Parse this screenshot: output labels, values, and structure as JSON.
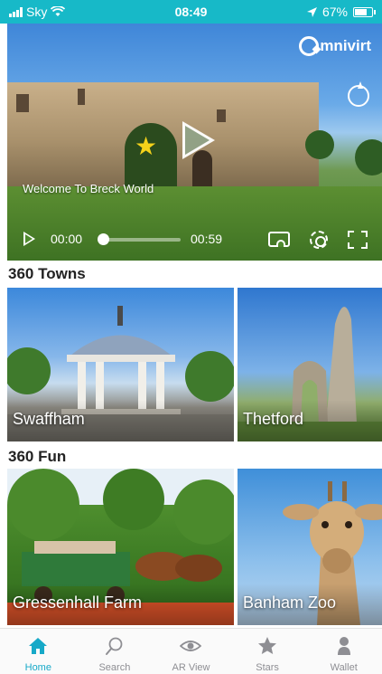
{
  "status_bar": {
    "carrier": "Sky",
    "time": "08:49",
    "battery": "67%"
  },
  "hero": {
    "brand": "mnivirt",
    "caption": "Welcome To Breck World",
    "current_time": "00:00",
    "duration": "00:59",
    "progress": 0
  },
  "towns": {
    "title": "360 Towns",
    "items": [
      {
        "label": "Swaffham"
      },
      {
        "label": "Thetford"
      }
    ]
  },
  "fun": {
    "title": "360 Fun",
    "items": [
      {
        "label": "Gressenhall Farm"
      },
      {
        "label": "Banham Zoo"
      }
    ]
  },
  "tabbar": {
    "items": [
      {
        "label": "Home",
        "icon": "home-icon",
        "active": true
      },
      {
        "label": "Search",
        "icon": "search-icon",
        "active": false
      },
      {
        "label": "AR View",
        "icon": "eye-icon",
        "active": false
      },
      {
        "label": "Stars",
        "icon": "star-icon",
        "active": false
      },
      {
        "label": "Wallet",
        "icon": "wallet-icon",
        "active": false
      }
    ]
  },
  "colors": {
    "accent": "#17b9c8",
    "tab_active": "#17a9c8",
    "tab_inactive": "#8e8e93"
  }
}
